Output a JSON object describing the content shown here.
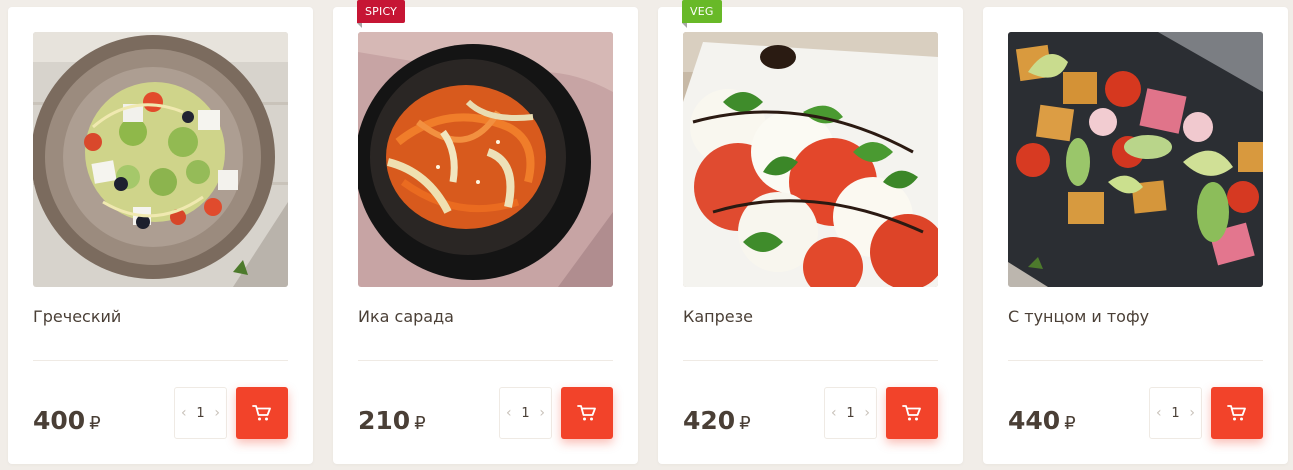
{
  "products": [
    {
      "name": "Греческий",
      "price": "400",
      "currency": "₽",
      "quantity": "1",
      "badge": "",
      "photo_icon": "greek-salad-photo"
    },
    {
      "name": "Ика сарада",
      "price": "210",
      "currency": "₽",
      "quantity": "1",
      "badge": "SPICY",
      "photo_icon": "squid-salad-photo"
    },
    {
      "name": "Капрезе",
      "price": "420",
      "currency": "₽",
      "quantity": "1",
      "badge": "VEG",
      "photo_icon": "caprese-photo"
    },
    {
      "name": "С тунцом и тофу",
      "price": "440",
      "currency": "₽",
      "quantity": "1",
      "badge": "",
      "photo_icon": "tuna-tofu-photo"
    }
  ],
  "stepper": {
    "decrement_icon": "chevron-left-icon",
    "increment_icon": "chevron-right-icon"
  },
  "cart": {
    "icon": "cart-icon"
  },
  "colors": {
    "accent": "#f2432a",
    "spicy_badge": "#c61534",
    "veg_badge": "#68b928",
    "text": "#4a3f36",
    "background": "#f1ede8"
  }
}
